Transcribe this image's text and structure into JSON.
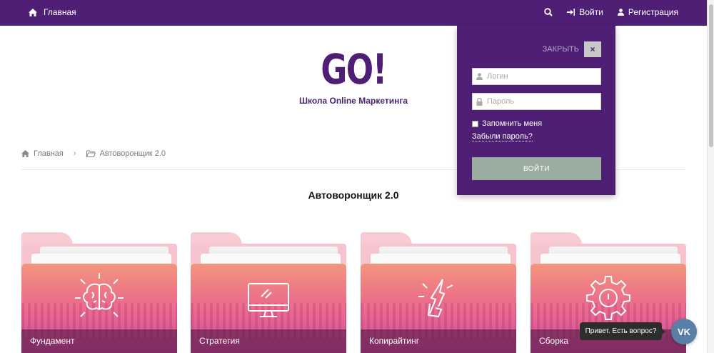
{
  "nav": {
    "home_label": "Главная",
    "login_label": "Войти",
    "register_label": "Регистрация"
  },
  "logo": {
    "text": "GO!",
    "tagline": "Школа Online Маркетинга"
  },
  "breadcrumb": {
    "home": "Главная",
    "current": "Автоворонщик 2.0",
    "separator": "›"
  },
  "page": {
    "title": "Автоворонщик 2.0"
  },
  "cards": [
    {
      "label": "Фундамент",
      "icon": "brain-icon"
    },
    {
      "label": "Стратегия",
      "icon": "monitor-icon"
    },
    {
      "label": "Копирайтинг",
      "icon": "pen-hand-icon"
    },
    {
      "label": "Сборка",
      "icon": "gear-icon"
    }
  ],
  "login_form": {
    "close_label": "ЗАКРЫТЬ",
    "close_symbol": "×",
    "login_placeholder": "Логин",
    "password_placeholder": "Пароль",
    "remember_label": "Запомнить меня",
    "forgot_label": "Забыли пароль?",
    "submit_label": "ВОЙТИ"
  },
  "chat": {
    "bubble_text": "Привет. Есть вопрос?",
    "vk_label": "VK"
  },
  "colors": {
    "brand_purple": "#4e1f75",
    "submit_button": "#9aada0",
    "vk_blue": "#5a7fa7"
  }
}
